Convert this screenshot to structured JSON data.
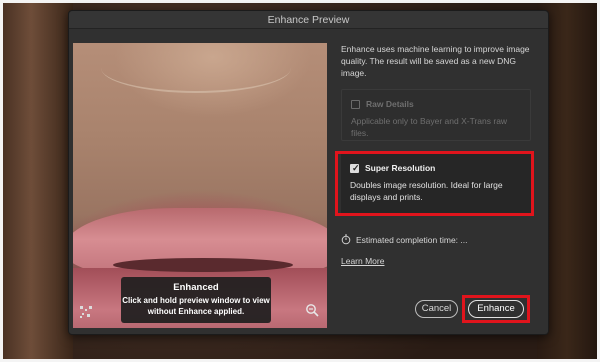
{
  "dialog": {
    "title": "Enhance Preview",
    "intro": "Enhance uses machine learning to improve image quality. The result will be saved as a new DNG image."
  },
  "preview": {
    "toast_title": "Enhanced",
    "toast_sub_line1": "Click and hold preview window to view",
    "toast_sub_line2": "without Enhance applied."
  },
  "options": {
    "raw_details": {
      "label": "Raw Details",
      "desc": "Applicable only to Bayer and X-Trans raw files.",
      "checked": false,
      "enabled": false
    },
    "super_resolution": {
      "label": "Super Resolution",
      "desc": "Doubles image resolution. Ideal for large displays and prints.",
      "checked": true,
      "enabled": true
    }
  },
  "estimate": {
    "text": "Estimated completion time: ..."
  },
  "links": {
    "learn_more": "Learn More"
  },
  "buttons": {
    "cancel": "Cancel",
    "enhance": "Enhance"
  },
  "icons": {
    "crop": "crop-grid-icon",
    "zoom": "zoom-out-icon",
    "stopwatch": "stopwatch-icon",
    "check": "checkmark-icon"
  },
  "colors": {
    "dialog_bg": "#303030",
    "highlight": "#e0141c",
    "text": "#d6d6d6"
  }
}
